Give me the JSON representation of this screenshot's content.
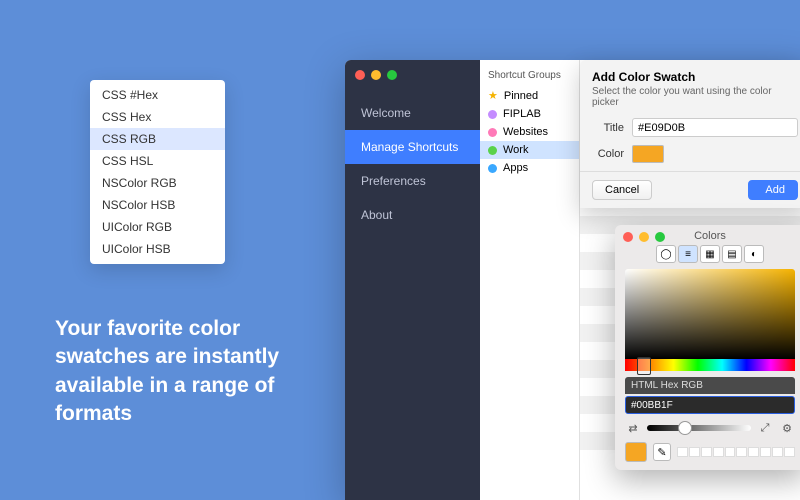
{
  "format_list": {
    "items": [
      "CSS #Hex",
      "CSS Hex",
      "CSS RGB",
      "CSS HSL",
      "NSColor RGB",
      "NSColor HSB",
      "UIColor RGB",
      "UIColor HSB"
    ],
    "selected_index": 2
  },
  "tagline": "Your favorite color swatches are instantly available in a range of formats",
  "sidebar": {
    "items": [
      "Welcome",
      "Manage Shortcuts",
      "Preferences",
      "About"
    ],
    "active_index": 1
  },
  "groups": {
    "header": "Shortcut Groups",
    "items": [
      {
        "label": "Pinned",
        "icon": "star",
        "color": "#f5b301"
      },
      {
        "label": "FIPLAB",
        "icon": "dot",
        "color": "#c48cff"
      },
      {
        "label": "Websites",
        "icon": "dot",
        "color": "#ff7ab8"
      },
      {
        "label": "Work",
        "icon": "dot",
        "color": "#5ad24a"
      },
      {
        "label": "Apps",
        "icon": "dot",
        "color": "#3aa8ff"
      }
    ],
    "selected_index": 3
  },
  "dialog": {
    "title": "Add Color Swatch",
    "subtitle": "Select the color you want using the color picker",
    "title_label": "Title",
    "title_value": "#E09D0B",
    "color_label": "Color",
    "swatch_color": "#f5a623",
    "cancel": "Cancel",
    "add": "Add"
  },
  "picker": {
    "window_title": "Colors",
    "mode_label": "HTML Hex RGB",
    "hex_value": "#00BB1F",
    "current_swatch": "#f5a623"
  }
}
